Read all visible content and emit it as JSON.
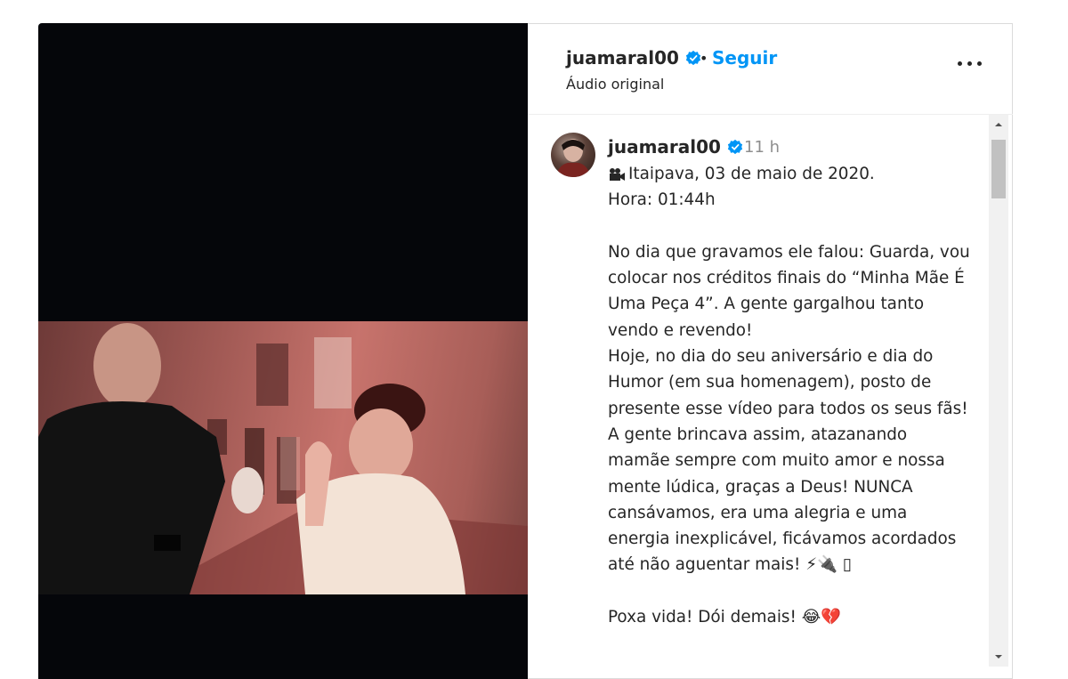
{
  "post": {
    "username": "juamaral00",
    "follow_label": "Seguir",
    "separator": "•",
    "audio_label": "Áudio original"
  },
  "comment": {
    "username": "juamaral00",
    "time": "11 h",
    "caption": "Itaipava, 03 de maio de 2020.\nHora: 01:44h\n\nNo dia que gravamos ele falou: Guarda, vou colocar nos créditos finais do “Minha Mãe É Uma Peça 4”. A gente gargalhou tanto vendo e revendo!\nHoje, no dia do seu aniversário e dia do Humor (em sua homenagem), posto de presente esse vídeo para todos os seus fãs!\nA gente brincava assim, atazanando mamãe sempre com muito amor e nossa mente lúdica, graças a Deus! NUNCA cansávamos, era uma alegria e uma energia inexplicável, ficávamos acordados até não aguentar mais! ⚡🔌 ▯\n\nPoxa vida! Dói demais! 😂💔"
  },
  "icons": {
    "verified": "verified-badge-icon",
    "camera": "movie-camera-icon",
    "more": "more-options-icon"
  },
  "colors": {
    "accent": "#0095f6",
    "muted": "#8e8e8e",
    "video_bg": "#05060a"
  }
}
